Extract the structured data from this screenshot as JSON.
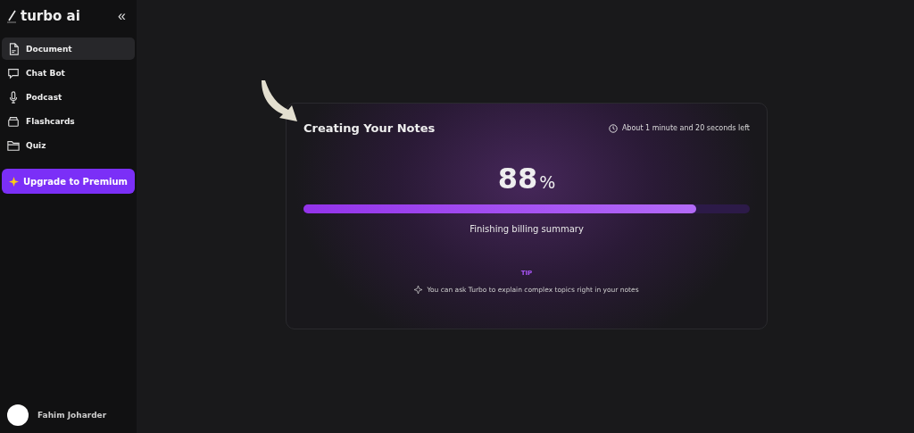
{
  "sidebar": {
    "logo": "turbo ai",
    "collapse": "«",
    "items": [
      {
        "label": "Document",
        "kind": "document",
        "selected": true
      },
      {
        "label": "Chat Bot",
        "kind": "chat",
        "selected": false
      },
      {
        "label": "Podcast",
        "kind": "mic",
        "selected": false
      },
      {
        "label": "Flashcards",
        "kind": "cards",
        "selected": false
      },
      {
        "label": "Quiz",
        "kind": "folder",
        "selected": false
      }
    ],
    "upgrade": "Upgrade to Premium",
    "user": {
      "name": "Fahim Joharder"
    }
  },
  "card": {
    "title": "Creating Your Notes",
    "eta": "About 1 minute and 20 seconds left",
    "percent": "88",
    "percent_sign": "%",
    "level": 0.88,
    "status": "Finishing billing summary",
    "tip_label": "TIP",
    "tip": "You can ask Turbo to explain complex topics right in your notes"
  }
}
